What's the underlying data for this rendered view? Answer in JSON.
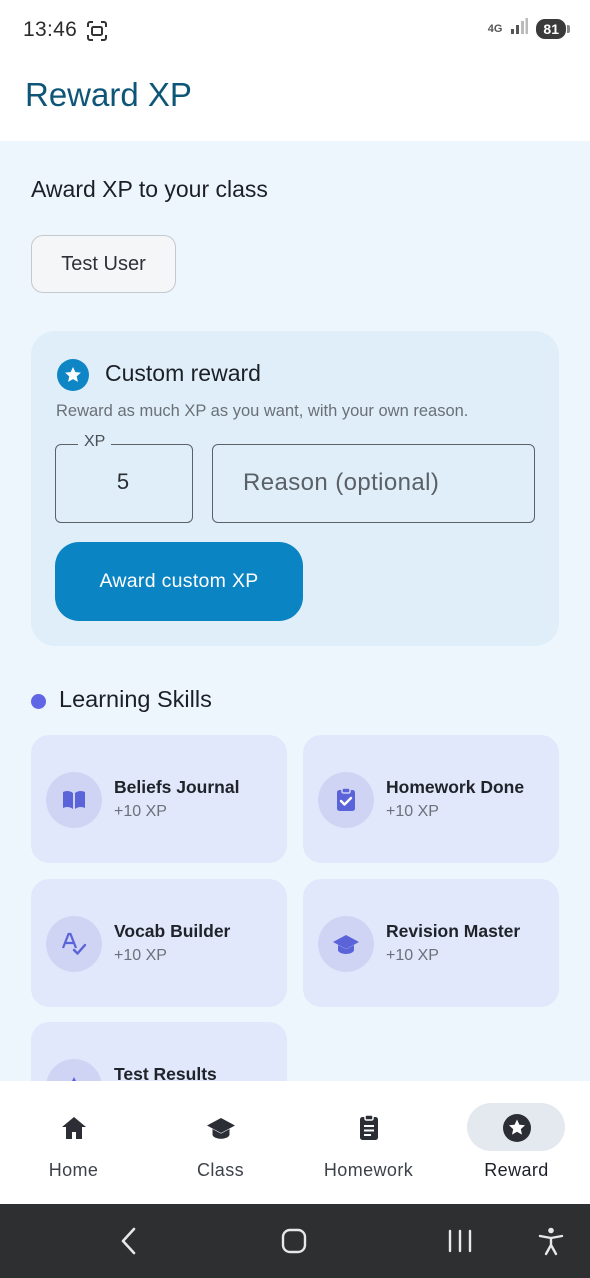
{
  "status_bar": {
    "time": "13:46",
    "network": "4G",
    "battery": "81"
  },
  "app_bar": {
    "title": "Reward XP"
  },
  "award": {
    "heading": "Award XP to your class",
    "user_chip": "Test User"
  },
  "custom_reward": {
    "title": "Custom reward",
    "description": "Reward as much XP as you want, with your own reason.",
    "xp_label": "XP",
    "xp_value": "5",
    "reason_placeholder": "Reason (optional)",
    "button_label": "Award custom XP",
    "accent_color": "#0a84c3"
  },
  "learning_skills": {
    "heading": "Learning Skills",
    "dot_color": "#6166e6",
    "items": [
      {
        "name": "Beliefs Journal",
        "xp": "+10 XP",
        "icon": "book-open-icon"
      },
      {
        "name": "Homework Done",
        "xp": "+10 XP",
        "icon": "clipboard-check-icon"
      },
      {
        "name": "Vocab Builder",
        "xp": "+10 XP",
        "icon": "spellcheck-icon"
      },
      {
        "name": "Revision Master",
        "xp": "+10 XP",
        "icon": "graduation-cap-icon"
      },
      {
        "name": "Test Results",
        "xp": "",
        "icon": "chart-icon"
      }
    ]
  },
  "bottom_nav": {
    "items": [
      {
        "label": "Home",
        "icon": "home-icon",
        "active": false
      },
      {
        "label": "Class",
        "icon": "graduation-cap-icon",
        "active": false
      },
      {
        "label": "Homework",
        "icon": "clipboard-icon",
        "active": false
      },
      {
        "label": "Reward",
        "icon": "star-circle-icon",
        "active": true
      }
    ]
  }
}
